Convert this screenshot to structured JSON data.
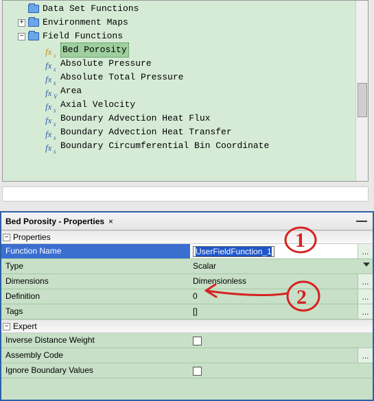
{
  "tree": {
    "items": [
      {
        "indent": "i1",
        "expander": "none",
        "icon": "folder",
        "label": "Data Set Functions"
      },
      {
        "indent": "i1",
        "expander": "plus",
        "icon": "folder",
        "label": "Environment Maps"
      },
      {
        "indent": "i1",
        "expander": "minus",
        "icon": "folder",
        "label": "Field Functions"
      },
      {
        "indent": "i3",
        "expander": "none",
        "icon": "fx-gold",
        "sub": "s",
        "label": "Bed Porosity",
        "selected": true
      },
      {
        "indent": "i3",
        "expander": "none",
        "icon": "fx",
        "sub": "s",
        "label": "Absolute Pressure"
      },
      {
        "indent": "i3",
        "expander": "none",
        "icon": "fx",
        "sub": "s",
        "label": "Absolute Total Pressure"
      },
      {
        "indent": "i3",
        "expander": "none",
        "icon": "fx",
        "sub": "V",
        "label": "Area"
      },
      {
        "indent": "i3",
        "expander": "none",
        "icon": "fx",
        "sub": "s",
        "label": "Axial Velocity"
      },
      {
        "indent": "i3",
        "expander": "none",
        "icon": "fx",
        "sub": "s",
        "label": "Boundary Advection Heat Flux"
      },
      {
        "indent": "i3",
        "expander": "none",
        "icon": "fx",
        "sub": "s",
        "label": "Boundary Advection Heat Transfer"
      },
      {
        "indent": "i3",
        "expander": "none",
        "icon": "fx",
        "sub": "s",
        "label": "Boundary Circumferential Bin Coordinate"
      }
    ]
  },
  "props": {
    "title": "Bed Porosity - Properties",
    "sections": {
      "properties": "Properties",
      "expert": "Expert"
    },
    "rows": {
      "function_name": {
        "k": "Function Name",
        "v": "UserFieldFunction_1"
      },
      "type": {
        "k": "Type",
        "v": "Scalar"
      },
      "dimensions": {
        "k": "Dimensions",
        "v": "Dimensionless"
      },
      "definition": {
        "k": "Definition",
        "v": "0"
      },
      "tags": {
        "k": "Tags",
        "v": "[]"
      },
      "inverse_distance_weight": {
        "k": "Inverse Distance Weight"
      },
      "assembly_code": {
        "k": "Assembly Code"
      },
      "ignore_boundary_values": {
        "k": "Ignore Boundary Values"
      }
    }
  },
  "annotations": {
    "label1": "1",
    "label2": "2"
  },
  "glyphs": {
    "ellipsis": "...",
    "close": "×",
    "minimize": "—",
    "plus": "+",
    "minus": "−",
    "fx": "fx"
  }
}
